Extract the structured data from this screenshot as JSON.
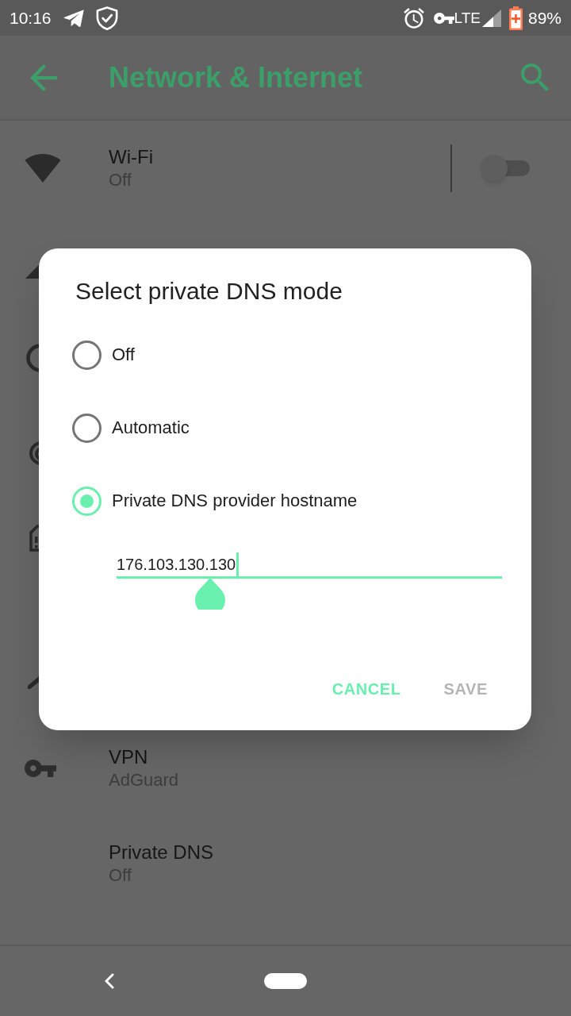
{
  "status_bar": {
    "time": "10:16",
    "network_type": "LTE",
    "battery": "89%"
  },
  "app_bar": {
    "title": "Network & Internet"
  },
  "settings_list": [
    {
      "kind": "toggle",
      "title": "Wi-Fi",
      "subtitle": "Off",
      "on": false
    },
    {
      "kind": "plain",
      "title": "VPN",
      "subtitle": "AdGuard"
    },
    {
      "kind": "plain",
      "title": "Private DNS",
      "subtitle": "Off"
    }
  ],
  "dialog": {
    "title": "Select private DNS mode",
    "options": [
      {
        "label": "Off",
        "selected": false
      },
      {
        "label": "Automatic",
        "selected": false
      },
      {
        "label": "Private DNS provider hostname",
        "selected": true
      }
    ],
    "hostname_field": {
      "value": "176.103.130.130"
    },
    "buttons": [
      {
        "label": "CANCEL",
        "disabled": false
      },
      {
        "label": "SAVE",
        "disabled": true
      }
    ]
  }
}
